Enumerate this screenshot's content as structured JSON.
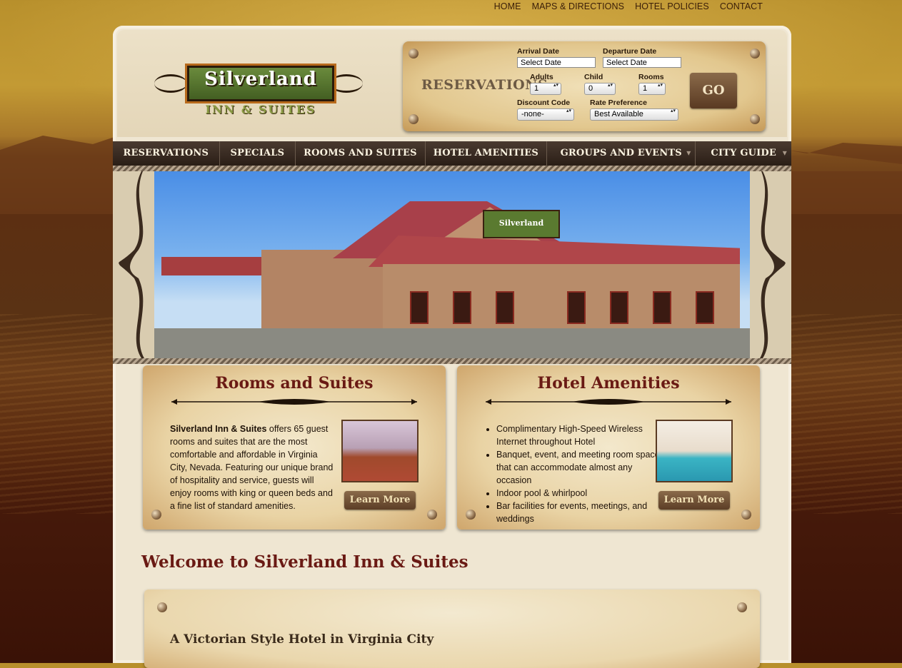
{
  "top_nav": {
    "items": [
      "HOME",
      "MAPS & DIRECTIONS",
      "HOTEL POLICIES",
      "CONTACT"
    ]
  },
  "logo": {
    "name": "Silverland",
    "sub": "INN & SUITES"
  },
  "reservations": {
    "title": "RESERVATIONS",
    "arrival_label": "Arrival Date",
    "arrival_value": "Select Date",
    "departure_label": "Departure Date",
    "departure_value": "Select Date",
    "adults_label": "Adults",
    "adults_value": "1",
    "child_label": "Child",
    "child_value": "0",
    "rooms_label": "Rooms",
    "rooms_value": "1",
    "discount_label": "Discount Code",
    "discount_value": "-none-",
    "rate_label": "Rate Preference",
    "rate_value": "Best Available",
    "go_label": "GO"
  },
  "main_nav": {
    "items": [
      {
        "label": "RESERVATIONS"
      },
      {
        "label": "SPECIALS"
      },
      {
        "label": "ROOMS AND SUITES"
      },
      {
        "label": "HOTEL AMENITIES"
      },
      {
        "label": "GROUPS AND EVENTS"
      },
      {
        "label": "CITY GUIDE"
      }
    ]
  },
  "hero": {
    "sign_text": "Silverland"
  },
  "cards": {
    "rooms": {
      "title": "Rooms and Suites",
      "text_bold": "Silverland Inn & Suites",
      "text": " offers 65 guest rooms and suites that are the most comfortable and affordable in Virginia City, Nevada. Featuring our unique brand of hospitality and service, guests will enjoy rooms with king or queen beds and a fine list of standard amenities.",
      "button": "Learn More"
    },
    "amenities": {
      "title": "Hotel Amenities",
      "bullets": [
        "Complimentary High-Speed Wireless Internet throughout Hotel",
        "Banquet, event, and meeting room space that can accommodate almost any occasion",
        "Indoor pool & whirlpool",
        "Bar facilities for events, meetings, and weddings"
      ],
      "button": "Learn More"
    }
  },
  "welcome": {
    "heading": "Welcome to Silverland Inn & Suites",
    "subheading": "A Victorian Style Hotel in Virginia City"
  },
  "colors": {
    "accent_red": "#6a1a14",
    "nav_bg": "#2a1e16",
    "page_bg": "#efe6d2"
  }
}
